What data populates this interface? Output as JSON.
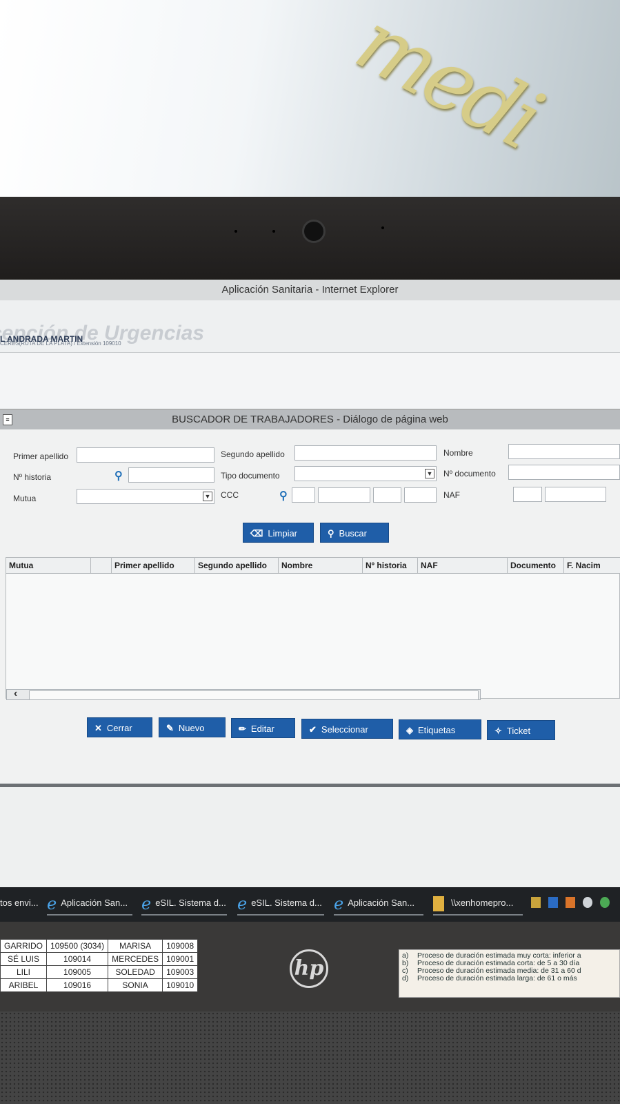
{
  "window": {
    "title": "Aplicación Sanitaria - Internet Explorer"
  },
  "app": {
    "title": "cepción de Urgencias",
    "user": "L ANDRADA MARTIN",
    "center": "CERES(RUTA DE LA PLATA) / Extensión 109010"
  },
  "dialog": {
    "title": "BUSCADOR DE TRABAJADORES - Diálogo de página web",
    "labels": {
      "primer_apellido": "Primer apellido",
      "segundo_apellido": "Segundo apellido",
      "nombre": "Nombre",
      "n_historia": "Nº historia",
      "tipo_documento": "Tipo documento",
      "n_documento": "Nº documento",
      "mutua": "Mutua",
      "ccc": "CCC",
      "naf": "NAF"
    },
    "buttons": {
      "limpiar": "Limpiar",
      "buscar": "Buscar"
    },
    "grid": {
      "columns": [
        "Mutua",
        "",
        "Primer apellido",
        "Segundo apellido",
        "Nombre",
        "Nº historia",
        "NAF",
        "Documento",
        "F. Nacim"
      ],
      "rows": []
    },
    "actions": {
      "cerrar": "Cerrar",
      "nuevo": "Nuevo",
      "editar": "Editar",
      "seleccionar": "Seleccionar",
      "etiquetas": "Etiquetas",
      "ticket": "Ticket"
    }
  },
  "taskbar": {
    "items": [
      "tos envi...",
      "Aplicación San...",
      "eSIL. Sistema d...",
      "eSIL. Sistema d...",
      "Aplicación San...",
      "\\\\xenhomepro..."
    ]
  },
  "sticker": {
    "rows": [
      [
        "GARRIDO",
        "109500 (3034)",
        "MARISA",
        "109008"
      ],
      [
        "SÉ LUIS",
        "109014",
        "MERCEDES",
        "109001"
      ],
      [
        "LILI",
        "109005",
        "SOLEDAD",
        "109003"
      ],
      [
        "ARIBEL",
        "109016",
        "SONIA",
        "109010"
      ]
    ]
  },
  "hp_logo": "hp",
  "notes": [
    [
      "a)",
      "Proceso de duración estimada muy corta: inferior a"
    ],
    [
      "b)",
      "Proceso de duración estimada corta: de 5 a 30 día"
    ],
    [
      "c)",
      "Proceso de duración estimada media: de 31 a 60 d"
    ],
    [
      "d)",
      "Proceso de duración estimada larga: de 61 o más"
    ]
  ],
  "colors": {
    "button_blue": "#1f5ea8",
    "link_blue": "#1f6fb8"
  }
}
